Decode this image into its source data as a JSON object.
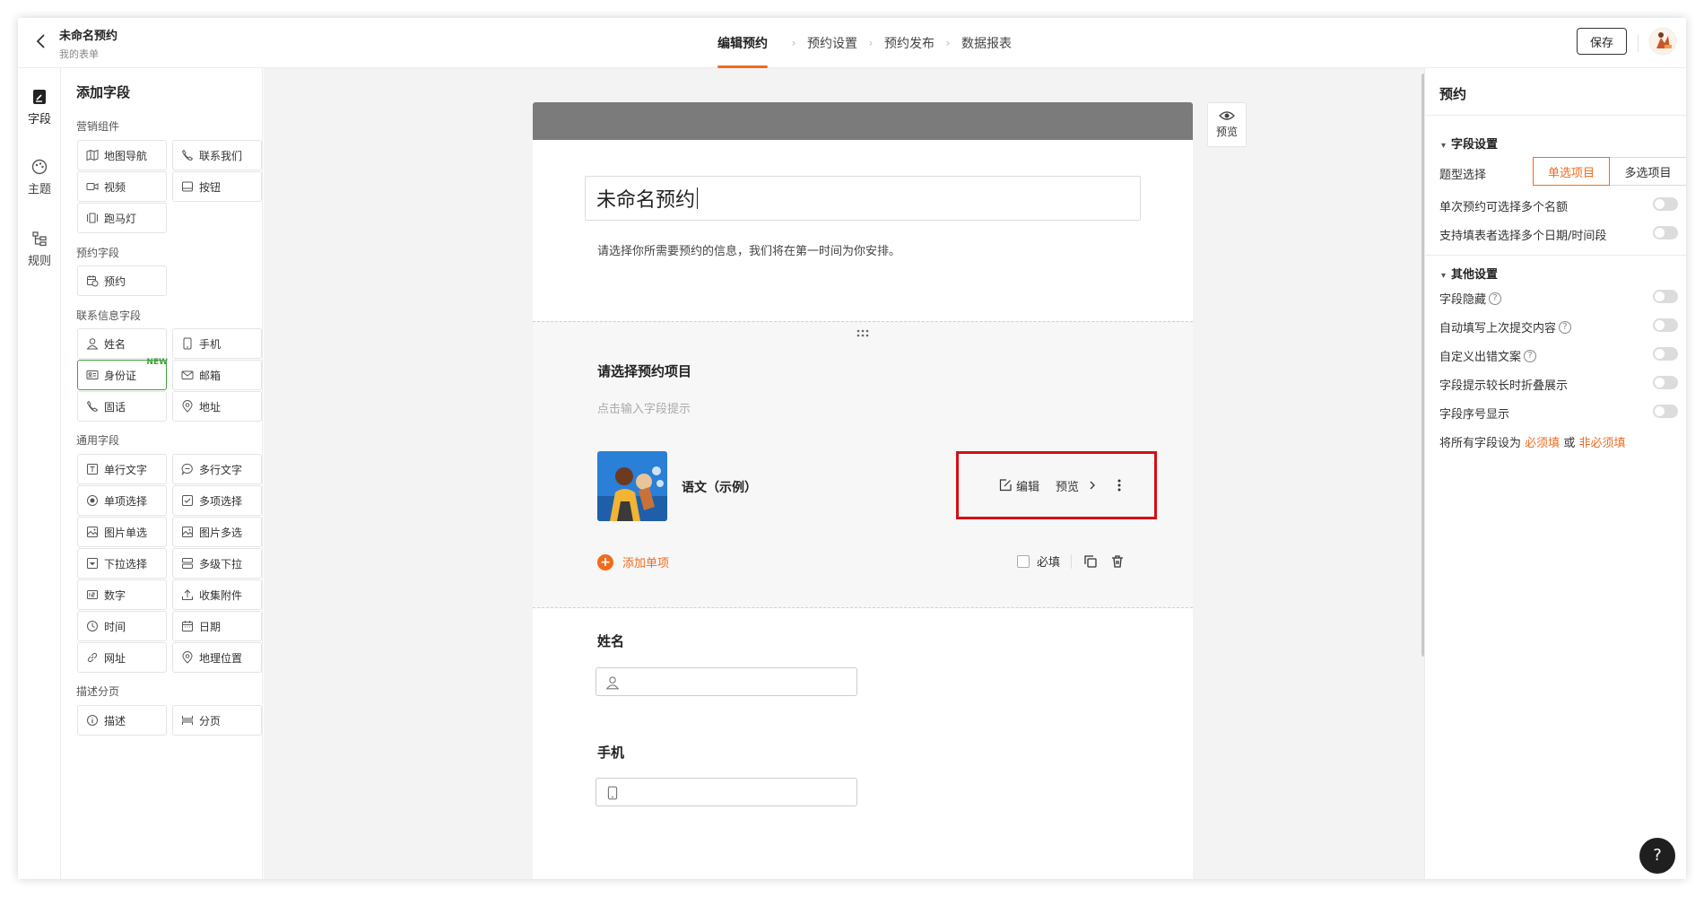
{
  "header": {
    "title": "未命名预约",
    "subtitle": "我的表单",
    "steps": [
      "编辑预约",
      "预约设置",
      "预约发布",
      "数据报表"
    ],
    "save_label": "保存"
  },
  "leftnav": {
    "items": [
      "字段",
      "主题",
      "规则"
    ]
  },
  "panel": {
    "title": "添加字段",
    "sections": {
      "marketing": {
        "title": "营销组件",
        "items": [
          "地图导航",
          "联系我们",
          "视频",
          "按钮",
          "跑马灯"
        ]
      },
      "booking": {
        "title": "预约字段",
        "items": [
          "预约"
        ]
      },
      "contact": {
        "title": "联系信息字段",
        "items": [
          "姓名",
          "手机",
          "身份证",
          "邮箱",
          "固话",
          "地址"
        ],
        "new_badge": "NEW"
      },
      "general": {
        "title": "通用字段",
        "items": [
          "单行文字",
          "多行文字",
          "单项选择",
          "多项选择",
          "图片单选",
          "图片多选",
          "下拉选择",
          "多级下拉",
          "数字",
          "收集附件",
          "时间",
          "日期",
          "网址",
          "地理位置"
        ]
      },
      "desc": {
        "title": "描述分页",
        "items": [
          "描述",
          "分页"
        ]
      }
    }
  },
  "form": {
    "title": "未命名预约",
    "description": "请选择你所需要预约的信息，我们将在第一时间为你安排。",
    "field": {
      "title": "请选择预约项目",
      "hint": "点击输入字段提示",
      "option_label": "语文（示例）",
      "edit_label": "编辑",
      "preview_label": "预览",
      "add_item_label": "添加单项",
      "required_label": "必填"
    },
    "name_label": "姓名",
    "phone_label": "手机"
  },
  "preview_label": "预览",
  "right_panel": {
    "title": "预约",
    "field_settings": {
      "title": "字段设置",
      "type_label": "题型选择",
      "type_options": [
        "单选项目",
        "多选项目"
      ],
      "selected_type": "单选项目",
      "toggles": [
        {
          "label": "单次预约可选择多个名额",
          "on": false
        },
        {
          "label": "支持填表者选择多个日期/时间段",
          "on": false
        }
      ]
    },
    "other_settings": {
      "title": "其他设置",
      "toggles": [
        {
          "label": "字段隐藏",
          "on": false
        },
        {
          "label": "自动填写上次提交内容",
          "on": false
        },
        {
          "label": "自定义出错文案",
          "on": false
        },
        {
          "label": "字段提示较长时折叠展示",
          "on": false
        },
        {
          "label": "字段序号显示",
          "on": false
        }
      ],
      "bulk_text": "将所有字段设为",
      "bulk_required": "必须填",
      "bulk_or": "或",
      "bulk_optional": "非必须填"
    }
  },
  "help_label": "?",
  "colors": {
    "accent": "#f26b1d",
    "highlight": "#d40f14",
    "banner": "#7b7b7b",
    "new_badge": "#3fa33c"
  }
}
